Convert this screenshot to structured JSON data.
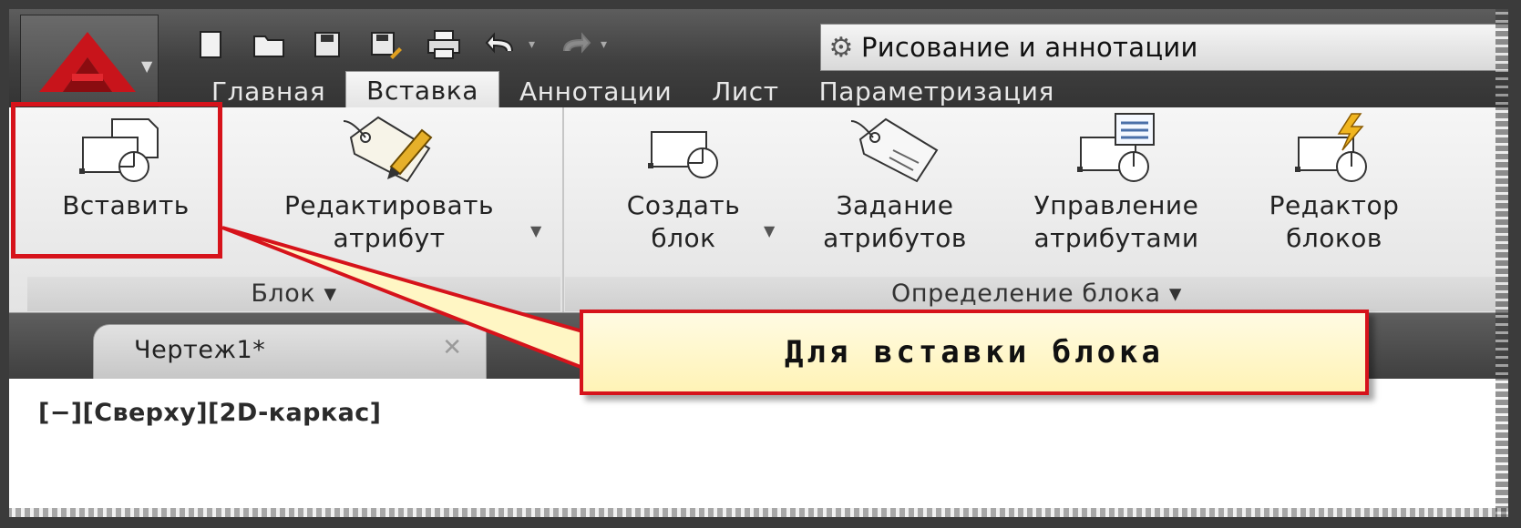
{
  "quick_access": {
    "workspace_label": "Рисование и аннотации",
    "icons": [
      "new-icon",
      "open-icon",
      "save-icon",
      "save-as-icon",
      "print-icon",
      "undo-icon",
      "redo-icon"
    ]
  },
  "tabs": [
    {
      "label": "Главная"
    },
    {
      "label": "Вставка",
      "active": true
    },
    {
      "label": "Аннотации"
    },
    {
      "label": "Лист"
    },
    {
      "label": "Параметризация"
    }
  ],
  "ribbon": {
    "block_panel": {
      "title": "Блок",
      "buttons": [
        {
          "label_l1": "Вставить",
          "label_l2": ""
        },
        {
          "label_l1": "Редактировать",
          "label_l2": "атрибут"
        }
      ]
    },
    "definition_panel": {
      "title": "Определение блока",
      "buttons": [
        {
          "label_l1": "Создать",
          "label_l2": "блок"
        },
        {
          "label_l1": "Задание",
          "label_l2": "атрибутов"
        },
        {
          "label_l1": "Управление",
          "label_l2": "атрибутами"
        },
        {
          "label_l1": "Редактор",
          "label_l2": "блоков"
        }
      ]
    }
  },
  "document": {
    "tab_label": "Чертеж1*",
    "close_glyph": "✕",
    "viewport_label": "[−][Сверху][2D-каркас]"
  },
  "callout": {
    "text": "Для вставки блока"
  },
  "colors": {
    "highlight": "#d6131b",
    "callout_bg": "#fff6c4",
    "logo_red": "#c8141b"
  }
}
